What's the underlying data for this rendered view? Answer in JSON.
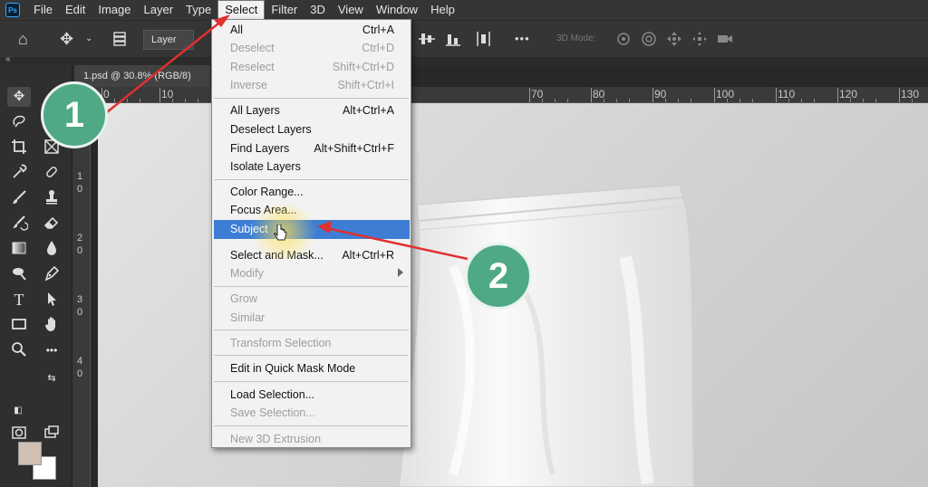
{
  "menubar": {
    "logo": "Ps",
    "items": [
      "File",
      "Edit",
      "Image",
      "Layer",
      "Type",
      "Select",
      "Filter",
      "3D",
      "View",
      "Window",
      "Help"
    ],
    "active": "Select"
  },
  "options": {
    "layer_select": "Layer",
    "mode_3d": "3D Mode:"
  },
  "document": {
    "tab_title": "1.psd @ 30.8% (RGB/8)"
  },
  "ruler": {
    "top_labels": [
      "0",
      "10",
      "70",
      "80",
      "90",
      "100",
      "110",
      "120",
      "130"
    ],
    "left_labels": [
      "1",
      "0",
      "2",
      "0",
      "3",
      "0",
      "4",
      "0"
    ]
  },
  "colors": {
    "foreground": "#cfc0b3",
    "background": "#ffffff",
    "highlight": "#3d7ed4",
    "annotation": "#4fa984",
    "arrow": "#e0302f"
  },
  "select_menu": {
    "items": [
      {
        "label": "All",
        "shortcut": "Ctrl+A",
        "disabled": false
      },
      {
        "label": "Deselect",
        "shortcut": "Ctrl+D",
        "disabled": true
      },
      {
        "label": "Reselect",
        "shortcut": "Shift+Ctrl+D",
        "disabled": true
      },
      {
        "label": "Inverse",
        "shortcut": "Shift+Ctrl+I",
        "disabled": true
      },
      {
        "label": "All Layers",
        "shortcut": "Alt+Ctrl+A",
        "disabled": false
      },
      {
        "label": "Deselect Layers",
        "shortcut": "",
        "disabled": false
      },
      {
        "label": "Find Layers",
        "shortcut": "Alt+Shift+Ctrl+F",
        "disabled": false
      },
      {
        "label": "Isolate Layers",
        "shortcut": "",
        "disabled": false
      },
      {
        "label": "Color Range...",
        "shortcut": "",
        "disabled": false
      },
      {
        "label": "Focus Area...",
        "shortcut": "",
        "disabled": false
      },
      {
        "label": "Subject",
        "shortcut": "",
        "disabled": false,
        "highlighted": true
      },
      {
        "label": "Select and Mask...",
        "shortcut": "Alt+Ctrl+R",
        "disabled": false
      },
      {
        "label": "Modify",
        "shortcut": "",
        "disabled": true,
        "submenu": true
      },
      {
        "label": "Grow",
        "shortcut": "",
        "disabled": true
      },
      {
        "label": "Similar",
        "shortcut": "",
        "disabled": true
      },
      {
        "label": "Transform Selection",
        "shortcut": "",
        "disabled": true
      },
      {
        "label": "Edit in Quick Mask Mode",
        "shortcut": "",
        "disabled": false
      },
      {
        "label": "Load Selection...",
        "shortcut": "",
        "disabled": false
      },
      {
        "label": "Save Selection...",
        "shortcut": "",
        "disabled": true
      },
      {
        "label": "New 3D Extrusion",
        "shortcut": "",
        "disabled": true
      }
    ]
  },
  "annotations": {
    "step1": "1",
    "step2": "2"
  },
  "icons": {
    "home": "⌂",
    "move": "✥",
    "more": "•••"
  }
}
